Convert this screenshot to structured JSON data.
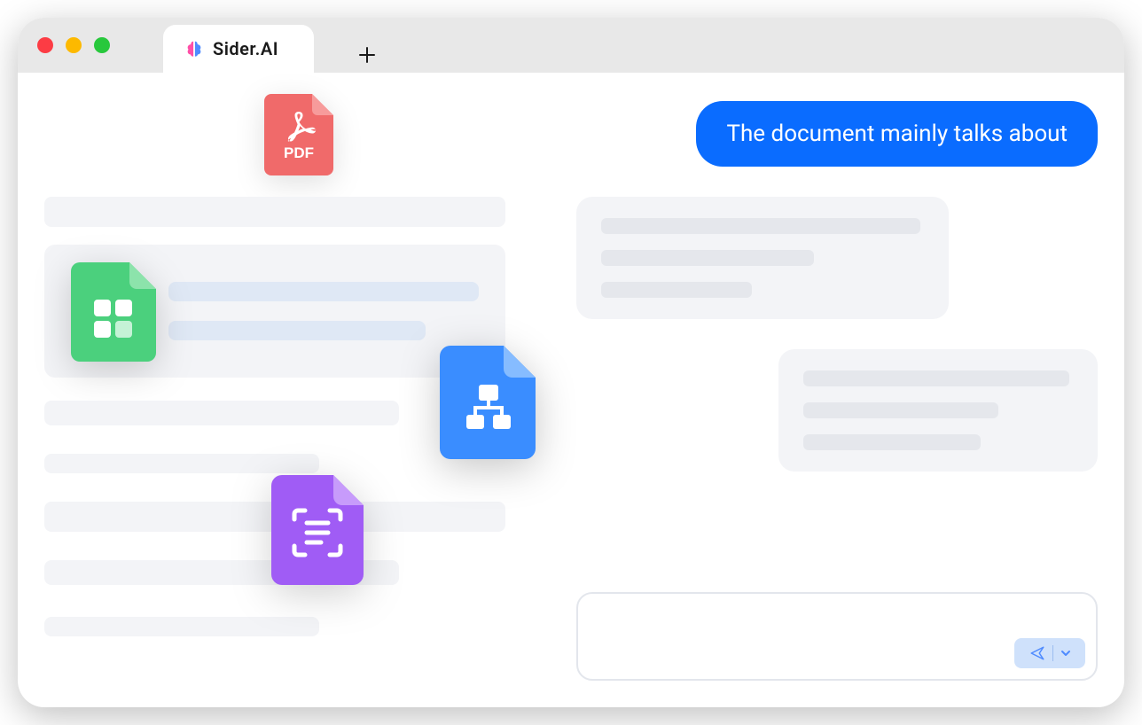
{
  "window": {
    "tab_title": "Sider.AI"
  },
  "icons": {
    "pdf_label": "PDF",
    "spreadsheet": "spreadsheet-icon",
    "flowchart": "flowchart-icon",
    "scan": "scan-doc-icon"
  },
  "chat": {
    "user_message": "The document mainly talks about",
    "input_placeholder": ""
  },
  "colors": {
    "accent": "#0a6cff",
    "pdf": "#f06a6a",
    "spreadsheet": "#4bd07d",
    "flow": "#3a8dff",
    "scan": "#a05cf5"
  }
}
